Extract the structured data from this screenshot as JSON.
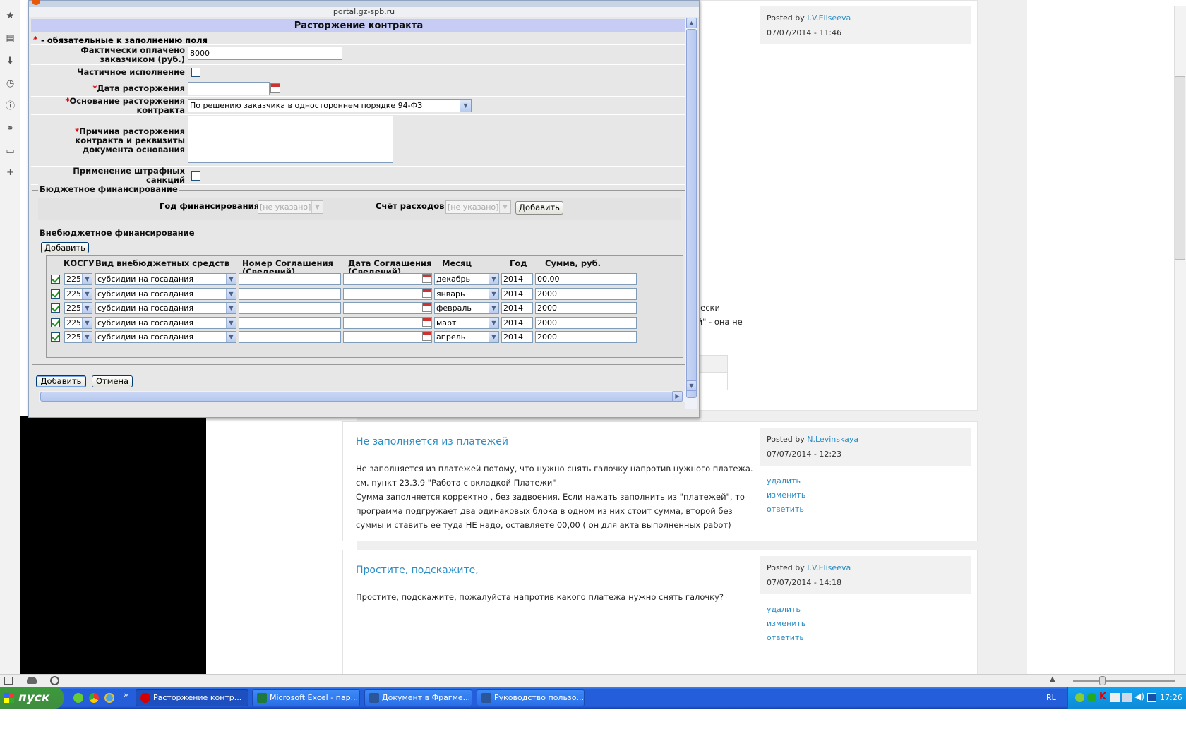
{
  "dialog": {
    "url": "portal.gz-spb.ru",
    "title": "Расторжение контракта",
    "required_note": "- обязательные к заполнению поля",
    "required_mark": "*",
    "paid_label": "Фактически оплачено заказчиком (руб.)",
    "paid_value": "8000",
    "partial_label": "Частичное исполнение",
    "date_label": "Дата расторжения",
    "basis_label": "Основание расторжения контракта",
    "basis_value": "По решению заказчика в одностороннем порядке 94-ФЗ",
    "reason_label": "Причина расторжения контракта и реквизиты документа основания",
    "penalty_label": "Применение штрафных санкций",
    "budget": {
      "legend": "Бюджетное финансирование",
      "year_label": "Год финансирования",
      "year_value": "[не указано]",
      "account_label": "Счёт расходов",
      "account_value": "[не указано]",
      "add_label": "Добавить"
    },
    "extra": {
      "legend": "Внебюджетное финансирование",
      "add_label": "Добавить",
      "headers": {
        "kosgu": "КОСГУ",
        "kind": "Вид внебюджетных средств",
        "number": "Номер Соглашения (Сведений)",
        "date": "Дата Соглашения (Сведений)",
        "month": "Месяц",
        "year": "Год",
        "sum": "Сумма, руб."
      },
      "rows": [
        {
          "kosgu": "225",
          "kind": "субсидии на госадания",
          "month": "декабрь",
          "year": "2014",
          "sum": "00.00"
        },
        {
          "kosgu": "225",
          "kind": "субсидии на госадания",
          "month": "январь",
          "year": "2014",
          "sum": "2000"
        },
        {
          "kosgu": "225",
          "kind": "субсидии на госадания",
          "month": "февраль",
          "year": "2014",
          "sum": "2000"
        },
        {
          "kosgu": "225",
          "kind": "субсидии на госадания",
          "month": "март",
          "year": "2014",
          "sum": "2000"
        },
        {
          "kosgu": "225",
          "kind": "субсидии на госадания",
          "month": "апрель",
          "year": "2014",
          "sum": "2000"
        }
      ]
    },
    "submit_label": "Добавить",
    "cancel_label": "Отмена"
  },
  "page": {
    "posted_by": "Posted by",
    "post1": {
      "author": "I.V.Eliseeva",
      "date": "07/07/2014 - 11:46",
      "partial_title": "...",
      "partial_text_1": "\"Фактически",
      "partial_text_2": "латежей\" - она не"
    },
    "post2": {
      "title": "Не заполняется из платежей",
      "author": "N.Levinskaya",
      "date": "07/07/2014 - 12:23",
      "lines": [
        "Не заполняется из платежей потому, что нужно снять галочку напротив нужного платежа.",
        "см. пункт 23.3.9 \"Работа с вкладкой Платежи\"",
        "Сумма заполняется корректно , без задвоения. Если нажать заполнить из \"платежей\", то",
        "программа подгружает два одинаковых блока в одном из них стоит сумма, второй без",
        "суммы и ставить ее туда НЕ надо, оставляете 00,00 ( он для акта выполненных работ)"
      ],
      "links": [
        "удалить",
        "изменить",
        "ответить"
      ]
    },
    "post3": {
      "title": "Простите, подскажите,",
      "author": "I.V.Eliseeva",
      "date": "07/07/2014 - 14:18",
      "text": "Простите, подскажите, пожалуйста напротив какого платежа нужно снять галочку?",
      "links": [
        "удалить",
        "изменить",
        "ответить"
      ]
    }
  },
  "taskbar": {
    "start": "пуск",
    "tasks": [
      {
        "label": "Расторжение контр...",
        "color": "#d40000"
      },
      {
        "label": "Microsoft Excel - пар...",
        "color": "#1d7a3a"
      },
      {
        "label": "Документ в Фрагме...",
        "color": "#2b579a"
      },
      {
        "label": "Руководство пользо...",
        "color": "#2b579a"
      }
    ],
    "lang": "RL",
    "clock": "17:26"
  }
}
